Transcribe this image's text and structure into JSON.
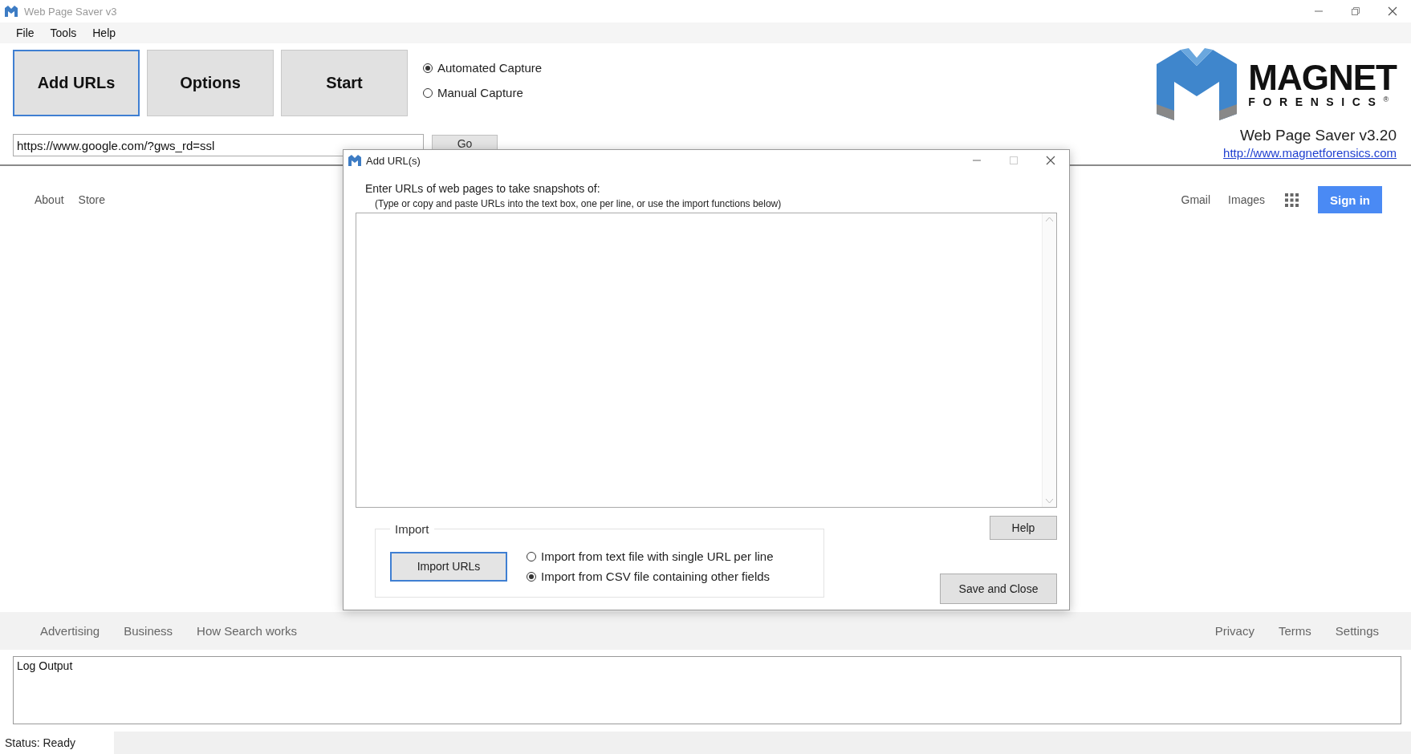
{
  "window": {
    "title": "Web Page Saver v3"
  },
  "menu": [
    "File",
    "Tools",
    "Help"
  ],
  "toolbar": {
    "buttons": [
      {
        "label": "Add URLs",
        "focused": true
      },
      {
        "label": "Options",
        "focused": false
      },
      {
        "label": "Start",
        "focused": false
      }
    ]
  },
  "capture_modes": [
    {
      "label": "Automated Capture",
      "selected": true
    },
    {
      "label": "Manual Capture",
      "selected": false
    }
  ],
  "logo": {
    "wordmark": "MAGNET",
    "subtitle": "FORENSICS",
    "registered": "®",
    "product": "Web Page Saver v3.20",
    "link": "http://www.magnetforensics.com"
  },
  "address_bar": {
    "value": "https://www.google.com/?gws_rd=ssl",
    "go_button": "Go"
  },
  "browser": {
    "top_left_links": [
      "About",
      "Store"
    ],
    "top_right_links": [
      "Gmail",
      "Images"
    ],
    "sign_in": "Sign in",
    "footer_left": [
      "Advertising",
      "Business",
      "How Search works"
    ],
    "footer_right": [
      "Privacy",
      "Terms",
      "Settings"
    ]
  },
  "log": {
    "label": "Log Output"
  },
  "status_bar": "Status: Ready",
  "dialog": {
    "title": "Add URL(s)",
    "prompt": "Enter URLs of web pages to take snapshots of:",
    "hint": "(Type or copy and paste URLs into the text box, one per line, or use the import functions below)",
    "import_group": {
      "title": "Import",
      "button": "Import URLs",
      "options": [
        {
          "label": "Import from text file with single URL per line",
          "selected": false
        },
        {
          "label": "Import from CSV file containing other fields",
          "selected": true
        }
      ]
    },
    "help_button": "Help",
    "save_button": "Save and Close"
  }
}
